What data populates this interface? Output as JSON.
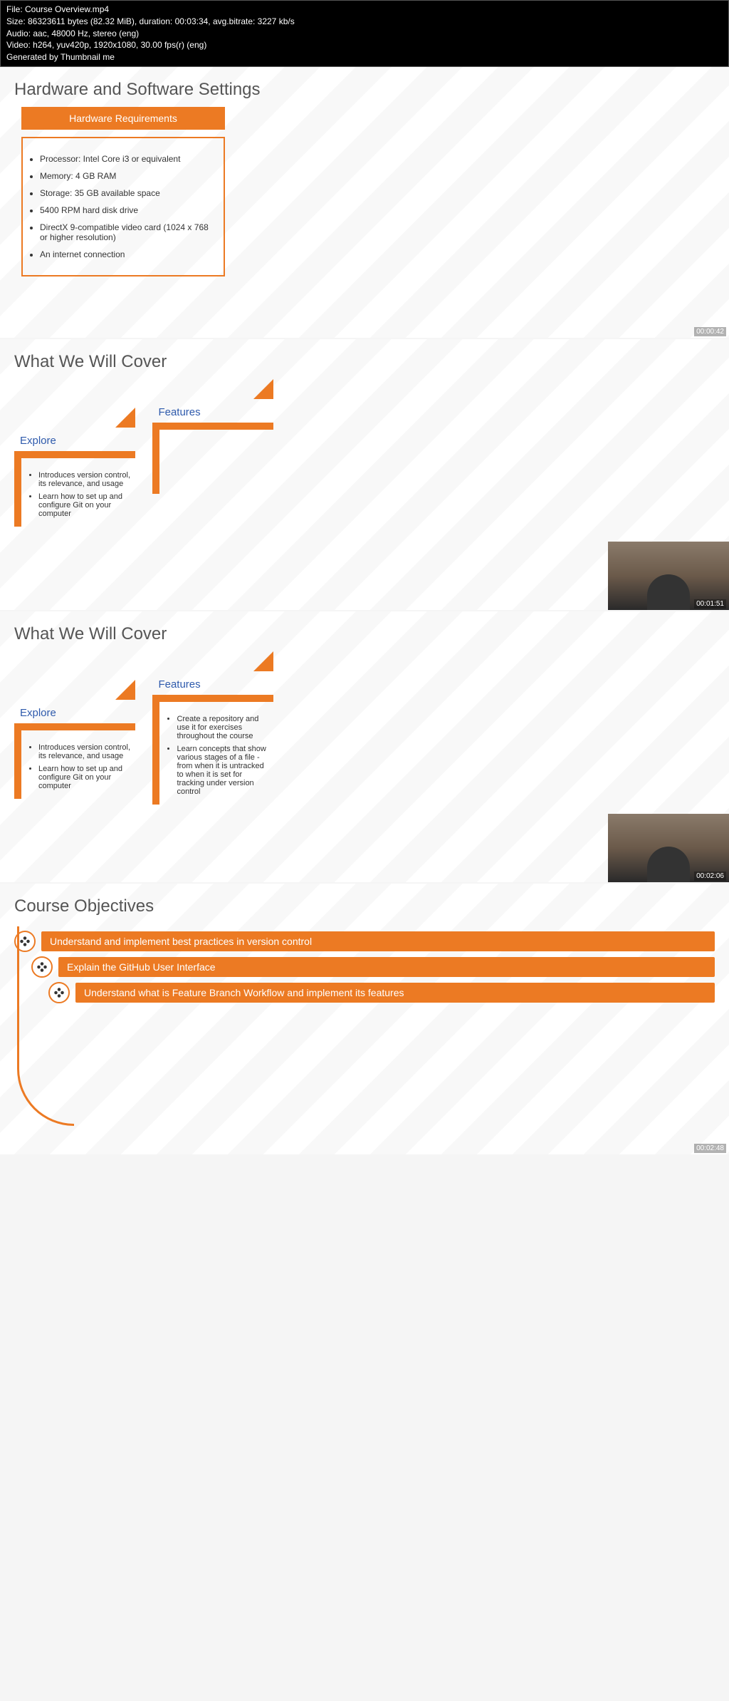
{
  "header": {
    "file": "File: Course Overview.mp4",
    "size": "Size: 86323611 bytes (82.32 MiB), duration: 00:03:34, avg.bitrate: 3227 kb/s",
    "audio": "Audio: aac, 48000 Hz, stereo (eng)",
    "video": "Video: h264, yuv420p, 1920x1080, 30.00 fps(r) (eng)",
    "generated": "Generated by Thumbnail me"
  },
  "slide1": {
    "title": "Hardware and Software Settings",
    "boxHeader": "Hardware Requirements",
    "items": [
      "Processor: Intel Core i3 or equivalent",
      "Memory: 4 GB RAM",
      "Storage: 35 GB available space",
      "5400 RPM hard disk drive",
      "DirectX 9-compatible video card (1024 x 768 or higher resolution)",
      "An internet connection"
    ],
    "timestamp": "00:00:42"
  },
  "slide2": {
    "title": "What We Will Cover",
    "col1Header": "Explore",
    "col2Header": "Features",
    "col1Items": [
      "Introduces version control, its relevance, and usage",
      "Learn how to set up and configure Git on your computer"
    ],
    "timestamp": "00:01:51"
  },
  "slide3": {
    "title": "What We Will Cover",
    "col1Header": "Explore",
    "col2Header": "Features",
    "col1Items": [
      "Introduces version control, its relevance, and usage",
      "Learn how to set up and configure Git on your computer"
    ],
    "col2Items": [
      "Create a repository and use it for exercises throughout the course",
      "Learn concepts that show various stages of a file - from when it is untracked to when it is set for tracking under version control"
    ],
    "timestamp": "00:02:06"
  },
  "slide4": {
    "title": "Course Objectives",
    "objectives": [
      "Understand and implement best practices in version control",
      "Explain the GitHub User Interface",
      "Understand what is Feature Branch Workflow and implement its features"
    ],
    "timestamp": "00:02:48"
  }
}
